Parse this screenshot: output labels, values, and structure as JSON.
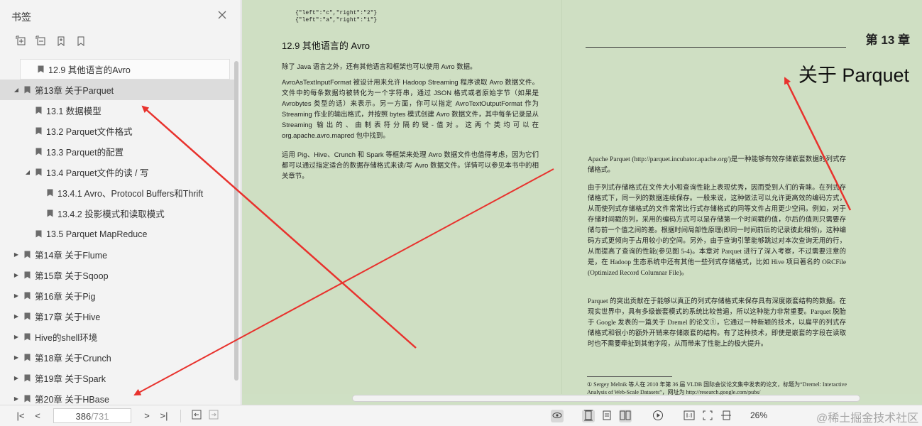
{
  "sidebar": {
    "title": "书签",
    "items": [
      {
        "label": "12.9 其他语言的Avro",
        "indent": 1,
        "tri": ""
      },
      {
        "label": "第13章 关于Parquet",
        "indent": 0,
        "tri": "◢"
      },
      {
        "label": "13.1 数据模型",
        "indent": 1,
        "tri": ""
      },
      {
        "label": "13.2 Parquet文件格式",
        "indent": 1,
        "tri": ""
      },
      {
        "label": "13.3 Parquet的配置",
        "indent": 1,
        "tri": ""
      },
      {
        "label": "13.4 Parquet文件的读 / 写",
        "indent": 1,
        "tri": "◢"
      },
      {
        "label": "13.4.1 Avro、Protocol Buffers和Thrift",
        "indent": 2,
        "tri": ""
      },
      {
        "label": "13.4.2 投影模式和读取模式",
        "indent": 2,
        "tri": ""
      },
      {
        "label": "13.5 Parquet MapReduce",
        "indent": 1,
        "tri": ""
      },
      {
        "label": "第14章 关于Flume",
        "indent": 0,
        "tri": "▶"
      },
      {
        "label": "第15章 关于Sqoop",
        "indent": 0,
        "tri": "▶"
      },
      {
        "label": "第16章 关于Pig",
        "indent": 0,
        "tri": "▶"
      },
      {
        "label": "第17章 关于Hive",
        "indent": 0,
        "tri": "▶"
      },
      {
        "label": "Hive的shell环境",
        "indent": 0,
        "tri": "▶"
      },
      {
        "label": "第18章 关于Crunch",
        "indent": 0,
        "tri": "▶"
      },
      {
        "label": "第19章 关于Spark",
        "indent": 0,
        "tri": "▶"
      },
      {
        "label": "第20章 关于HBase",
        "indent": 0,
        "tri": "▶"
      }
    ]
  },
  "doc": {
    "code": "{\"left\":\"c\",\"right\":\"2\"}\n{\"left\":\"a\",\"right\":\"1\"}",
    "section_title": "12.9   其他语言的 Avro",
    "left_p1": "除了 Java 语言之外，还有其他语言和框架也可以使用 Avro 数据。",
    "left_p2": "AvroAsTextInputFormat 被设计用来允许 Hadoop Streaming 程序读取 Avro 数据文件。文件中的每条数据均被转化为一个字符串，通过 JSON 格式或者原始字节（如果是 Avrobytes 类型的话）来表示。另一方面，你可以指定 AvroTextOutputFormat 作为 Streaming 作业的输出格式，并按照 bytes 模式创建 Avro 数据文件，其中每条记录是从 Streaming 输出的、由制表符分隔的键-值对。这两个类均可以在 org.apache.avro.mapred 包中找到。",
    "left_p3": "运用 Pig、Hive、Crunch 和 Spark 等框架来处理 Avro 数据文件也值得考虑，因为它们都可以通过指定适合的数据存储格式来读/写 Avro 数据文件。详情可以参见本书中的相关章节。",
    "chapter_label": "第 13 章",
    "chapter_title": "关于 Parquet",
    "right_p1": "Apache Parquet (http://parquet.incubator.apache.org/)是一种能够有效存储嵌套数据的列式存储格式。",
    "right_p2": "由于列式存储格式在文件大小和查询性能上表现优秀，因而受到人们的青睐。在列式存储格式下，同一列的数据连续保存。一般来说，这种做法可以允许更高效的编码方式，从而使列式存储格式的文件常常比行式存储格式的同等文件占用更少空间。例如，对于存储时间戳的列，采用的编码方式可以是存储第一个时间戳的值，尔后的值则只需要存储与前一个值之间的差。根据时间局部性原理(即同一时间前后的记录彼此相邻)，这种编码方式更倾向于占用较小的空间。另外，由于查询引擎能够跳过对本次查询无用的行，从而提高了查询的性能(参见图 5-4)。本章对 Parquet 进行了深入考察，不过需要注意的是，在 Hadoop 生态系统中还有其他一些列式存储格式，比如 Hive 项目著名的 ORCFile (Optimized Record Columnar File)。",
    "right_p3": "Parquet 的突出贡献在于能够以真正的列式存储格式来保存具有深度嵌套结构的数据。在现实世界中，具有多级嵌套模式的系统比较普遍，所以这种能力非常重要。Parquet 脱胎于 Google 发表的一篇关于 Dremel 的论文①，它通过一种新颖的技术，以扁平的列式存储格式和很小的额外开销来存储嵌套的结构。有了这种技术，即使是嵌套的字段在读取时也不需要牵扯到其他字段，从而带来了性能上的极大提升。",
    "footnote": "① Sergey Melnik 等人在 2010 年第 36 届 VLDB 国际会议论文集中发表的论文，标题为“Dremel: Interactive Analysis of Web-Scale Datasets”，网址为 http://research.google.com/pubs/"
  },
  "toolbar": {
    "page_current": "386",
    "page_total": "/731",
    "zoom": "26%",
    "watermark": "@稀土掘金技术社区"
  },
  "colors": {
    "page_bg": "#cfdfc3",
    "arrow": "#e8322d"
  }
}
